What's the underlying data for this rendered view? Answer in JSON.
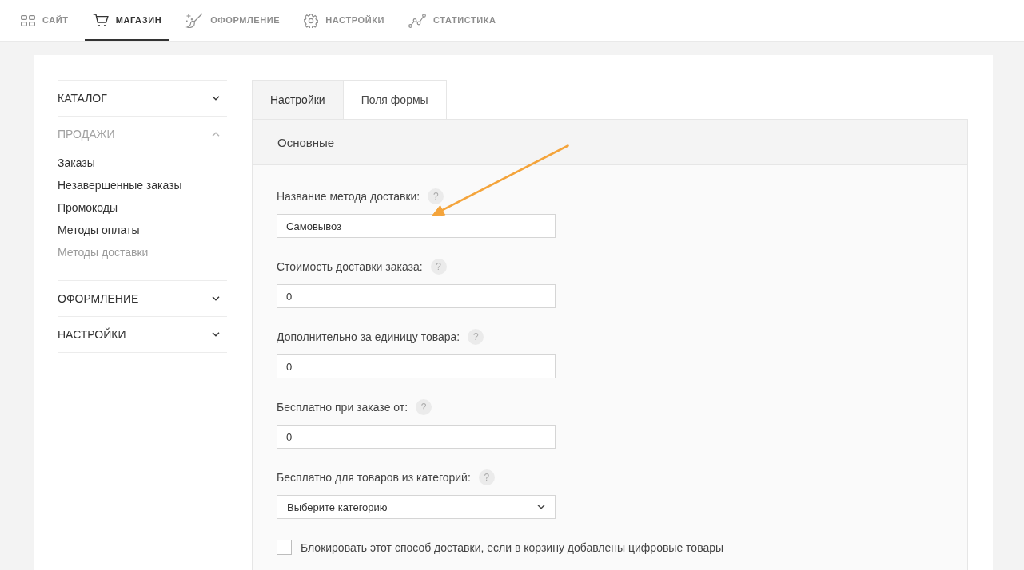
{
  "top_nav": [
    {
      "label": "САЙТ",
      "selected": false
    },
    {
      "label": "МАГАЗИН",
      "selected": true
    },
    {
      "label": "ОФОРМЛЕНИЕ",
      "selected": false
    },
    {
      "label": "НАСТРОЙКИ",
      "selected": false
    },
    {
      "label": "СТАТИСТИКА",
      "selected": false
    }
  ],
  "sidebar": [
    {
      "label": "КАТАЛОГ",
      "expanded": false
    },
    {
      "label": "ПРОДАЖИ",
      "expanded": true,
      "children": [
        {
          "label": "Заказы",
          "selected": false
        },
        {
          "label": "Незавершенные заказы",
          "selected": false
        },
        {
          "label": "Промокоды",
          "selected": false
        },
        {
          "label": "Методы оплаты",
          "selected": false
        },
        {
          "label": "Методы доставки",
          "selected": true
        }
      ]
    },
    {
      "label": "ОФОРМЛЕНИЕ",
      "expanded": false
    },
    {
      "label": "НАСТРОЙКИ",
      "expanded": false
    }
  ],
  "tabs": [
    {
      "label": "Настройки",
      "selected": true
    },
    {
      "label": "Поля формы",
      "selected": false
    }
  ],
  "panel": {
    "title": "Основные",
    "fields": [
      {
        "kind": "text",
        "label": "Название метода доставки:",
        "help": "?",
        "value": "Самовывоз"
      },
      {
        "kind": "text",
        "label": "Стоимость доставки заказа:",
        "help": "?",
        "value": "0"
      },
      {
        "kind": "text",
        "label": "Дополнительно за единицу товара:",
        "help": "?",
        "value": "0"
      },
      {
        "kind": "text",
        "label": "Бесплатно при заказе от:",
        "help": "?",
        "value": "0"
      },
      {
        "kind": "select",
        "label": "Бесплатно для товаров из категорий:",
        "help": "?",
        "value": "Выберите категорию"
      },
      {
        "kind": "checkbox",
        "label": "Блокировать этот способ доставки, если в корзину добавлены цифровые товары",
        "checked": false
      }
    ]
  }
}
